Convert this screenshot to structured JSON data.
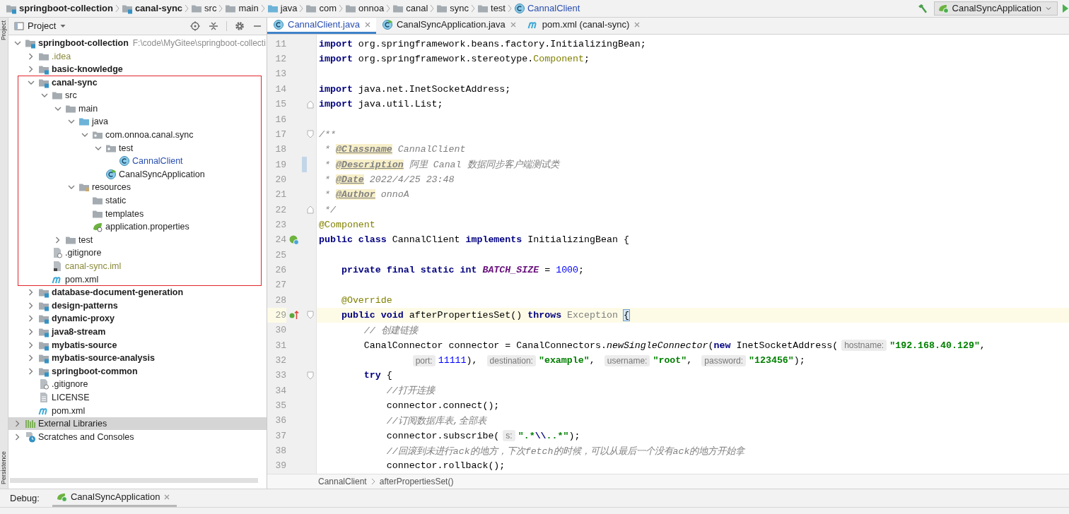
{
  "breadcrumbs": [
    {
      "label": "springboot-collection",
      "kind": "module"
    },
    {
      "label": "canal-sync",
      "kind": "module"
    },
    {
      "label": "src",
      "kind": "folder"
    },
    {
      "label": "main",
      "kind": "folder"
    },
    {
      "label": "java",
      "kind": "source-folder"
    },
    {
      "label": "com",
      "kind": "folder"
    },
    {
      "label": "onnoa",
      "kind": "folder"
    },
    {
      "label": "canal",
      "kind": "folder"
    },
    {
      "label": "sync",
      "kind": "folder"
    },
    {
      "label": "test",
      "kind": "folder"
    },
    {
      "label": "CannalClient",
      "kind": "class"
    }
  ],
  "run_config": {
    "label": "CanalSyncApplication"
  },
  "tool_strip": [
    "Project",
    "Persistence"
  ],
  "project_panel": {
    "title": "Project"
  },
  "project_tree": [
    {
      "label": "springboot-collection",
      "kind": "module",
      "path": "F:\\code\\MyGitee\\springboot-collecti",
      "expanded": true,
      "selected": false,
      "highlighted": false,
      "children": [
        {
          "label": ".idea",
          "kind": "folder",
          "color": "#8a8a3c",
          "expanded": false,
          "selected": false,
          "highlighted": false
        },
        {
          "label": "basic-knowledge",
          "kind": "module",
          "expanded": false,
          "selected": false,
          "highlighted": false
        },
        {
          "label": "canal-sync",
          "kind": "module",
          "expanded": true,
          "selected": false,
          "highlighted": true,
          "children": [
            {
              "label": "src",
              "kind": "folder",
              "expanded": true,
              "selected": false,
              "highlighted": false,
              "children": [
                {
                  "label": "main",
                  "kind": "folder",
                  "expanded": true,
                  "selected": false,
                  "highlighted": false,
                  "children": [
                    {
                      "label": "java",
                      "kind": "source-folder",
                      "expanded": true,
                      "selected": false,
                      "highlighted": false,
                      "children": [
                        {
                          "label": "com.onnoa.canal.sync",
                          "kind": "package",
                          "expanded": true,
                          "selected": false,
                          "highlighted": false,
                          "children": [
                            {
                              "label": "test",
                              "kind": "package",
                              "expanded": true,
                              "selected": false,
                              "highlighted": false,
                              "children": [
                                {
                                  "label": "CannalClient",
                                  "kind": "class",
                                  "color": "#2a4fb0",
                                  "selected": false,
                                  "highlighted": false
                                }
                              ]
                            },
                            {
                              "label": "CanalSyncApplication",
                              "kind": "spring-class",
                              "selected": false,
                              "highlighted": false
                            }
                          ]
                        }
                      ]
                    },
                    {
                      "label": "resources",
                      "kind": "resources-folder",
                      "expanded": true,
                      "selected": false,
                      "highlighted": false,
                      "children": [
                        {
                          "label": "static",
                          "kind": "folder",
                          "selected": false,
                          "highlighted": false
                        },
                        {
                          "label": "templates",
                          "kind": "folder",
                          "selected": false,
                          "highlighted": false
                        },
                        {
                          "label": "application.properties",
                          "kind": "properties",
                          "selected": false,
                          "highlighted": false
                        }
                      ]
                    }
                  ]
                },
                {
                  "label": "test",
                  "kind": "folder",
                  "expanded": false,
                  "selected": false,
                  "highlighted": false
                }
              ]
            },
            {
              "label": ".gitignore",
              "kind": "gitignore",
              "selected": false,
              "highlighted": false
            },
            {
              "label": "canal-sync.iml",
              "kind": "iml",
              "color": "#8a8a3c",
              "selected": false,
              "highlighted": false
            },
            {
              "label": "pom.xml",
              "kind": "pom",
              "selected": false,
              "highlighted": false
            }
          ]
        },
        {
          "label": "database-document-generation",
          "kind": "module",
          "expanded": false,
          "selected": false,
          "highlighted": false
        },
        {
          "label": "design-patterns",
          "kind": "module",
          "expanded": false,
          "selected": false,
          "highlighted": false
        },
        {
          "label": "dynamic-proxy",
          "kind": "module",
          "expanded": false,
          "selected": false,
          "highlighted": false
        },
        {
          "label": "java8-stream",
          "kind": "module",
          "expanded": false,
          "selected": false,
          "highlighted": false
        },
        {
          "label": "mybatis-source",
          "kind": "module",
          "expanded": false,
          "selected": false,
          "highlighted": false
        },
        {
          "label": "mybatis-source-analysis",
          "kind": "module",
          "expanded": false,
          "selected": false,
          "highlighted": false
        },
        {
          "label": "springboot-common",
          "kind": "module",
          "expanded": false,
          "selected": false,
          "highlighted": false
        },
        {
          "label": ".gitignore",
          "kind": "gitignore",
          "selected": false,
          "highlighted": false
        },
        {
          "label": "LICENSE",
          "kind": "text-file",
          "selected": false,
          "highlighted": false
        },
        {
          "label": "pom.xml",
          "kind": "pom",
          "selected": false,
          "highlighted": false
        }
      ]
    },
    {
      "label": "External Libraries",
      "kind": "libraries",
      "expanded": false,
      "selected": true,
      "highlighted": false
    },
    {
      "label": "Scratches and Consoles",
      "kind": "scratches",
      "expanded": false,
      "selected": false,
      "highlighted": false
    }
  ],
  "tabs": [
    {
      "label": "CannalClient.java",
      "kind": "class",
      "selected": true
    },
    {
      "label": "CanalSyncApplication.java",
      "kind": "spring-class",
      "selected": false
    },
    {
      "label": "pom.xml (canal-sync)",
      "kind": "pom",
      "selected": false
    }
  ],
  "code_lines": [
    {
      "number": "11",
      "kind": "code",
      "current": false,
      "tokens": [
        {
          "kind": "kw",
          "text": "import "
        },
        {
          "kind": "plain",
          "text": "org.springframework.beans.factory.InitializingBean;"
        }
      ]
    },
    {
      "number": "12",
      "kind": "code",
      "current": false,
      "tokens": [
        {
          "kind": "kw",
          "text": "import "
        },
        {
          "kind": "plain",
          "text": "org.springframework.stereotype."
        },
        {
          "kind": "anno",
          "text": "Component"
        },
        {
          "kind": "plain",
          "text": ";"
        }
      ]
    },
    {
      "number": "13",
      "kind": "blank",
      "current": false
    },
    {
      "number": "14",
      "kind": "code",
      "current": false,
      "tokens": [
        {
          "kind": "kw",
          "text": "import "
        },
        {
          "kind": "plain",
          "text": "java.net.InetSocketAddress;"
        }
      ]
    },
    {
      "number": "15",
      "kind": "code",
      "current": false,
      "fold": {
        "kind": "end"
      },
      "tokens": [
        {
          "kind": "kw",
          "text": "import "
        },
        {
          "kind": "plain",
          "text": "java.util.List;"
        }
      ]
    },
    {
      "number": "16",
      "kind": "blank",
      "current": false
    },
    {
      "number": "17",
      "kind": "code",
      "current": false,
      "fold": {
        "kind": "start"
      },
      "tokens": [
        {
          "kind": "doc",
          "text": "/**"
        }
      ]
    },
    {
      "number": "18",
      "kind": "code",
      "current": false,
      "tokens": [
        {
          "kind": "doc",
          "text": " * "
        },
        {
          "kind": "doctag",
          "text": "@Classname"
        },
        {
          "kind": "doc",
          "text": " CannalClient"
        }
      ]
    },
    {
      "number": "19",
      "kind": "code",
      "current": false,
      "change": {
        "kind": "modified"
      },
      "tokens": [
        {
          "kind": "doc",
          "text": " * "
        },
        {
          "kind": "doctag",
          "text": "@Description"
        },
        {
          "kind": "doc",
          "text": " 阿里 Canal 数据同步客户端测试类"
        }
      ]
    },
    {
      "number": "20",
      "kind": "code",
      "current": false,
      "tokens": [
        {
          "kind": "doc",
          "text": " * "
        },
        {
          "kind": "doctag",
          "text": "@Date"
        },
        {
          "kind": "doc",
          "text": " 2022/4/25 23:48"
        }
      ]
    },
    {
      "number": "21",
      "kind": "code",
      "current": false,
      "tokens": [
        {
          "kind": "doc",
          "text": " * "
        },
        {
          "kind": "doctag",
          "text": "@Author"
        },
        {
          "kind": "doc",
          "text": " onnoA"
        }
      ]
    },
    {
      "number": "22",
      "kind": "code",
      "current": false,
      "fold": {
        "kind": "end"
      },
      "tokens": [
        {
          "kind": "doc",
          "text": " */"
        }
      ]
    },
    {
      "number": "23",
      "kind": "code",
      "current": false,
      "tokens": [
        {
          "kind": "anno",
          "text": "@Component"
        }
      ]
    },
    {
      "number": "24",
      "kind": "code",
      "current": false,
      "gutter_marker": {
        "kind": "bean"
      },
      "tokens": [
        {
          "kind": "kw",
          "text": "public class "
        },
        {
          "kind": "plain",
          "text": "CannalClient "
        },
        {
          "kind": "kw",
          "text": "implements "
        },
        {
          "kind": "plain",
          "text": "InitializingBean {"
        }
      ]
    },
    {
      "number": "25",
      "kind": "blank",
      "current": false
    },
    {
      "number": "26",
      "kind": "code",
      "current": false,
      "tokens": [
        {
          "kind": "kw",
          "text": "    private final static int "
        },
        {
          "kind": "const",
          "text": "BATCH_SIZE"
        },
        {
          "kind": "plain",
          "text": " = "
        },
        {
          "kind": "num",
          "text": "1000"
        },
        {
          "kind": "plain",
          "text": ";"
        }
      ]
    },
    {
      "number": "27",
      "kind": "blank",
      "current": false
    },
    {
      "number": "28",
      "kind": "code",
      "current": false,
      "tokens": [
        {
          "kind": "anno",
          "text": "    @Override"
        }
      ]
    },
    {
      "number": "29",
      "kind": "code",
      "current": true,
      "gutter_marker": {
        "kind": "implements"
      },
      "fold": {
        "kind": "start"
      },
      "tokens": [
        {
          "kind": "kw",
          "text": "    public void "
        },
        {
          "kind": "plain",
          "text": "afterPropertiesSet() "
        },
        {
          "kind": "kw",
          "text": "throws "
        },
        {
          "kind": "muted",
          "text": "Exception "
        },
        {
          "kind": "brace",
          "text": "{"
        }
      ]
    },
    {
      "number": "30",
      "kind": "code",
      "current": false,
      "tokens": [
        {
          "kind": "comment",
          "text": "        // 创建链接"
        }
      ]
    },
    {
      "number": "31",
      "kind": "code",
      "current": false,
      "tokens": [
        {
          "kind": "plain",
          "text": "        CanalConnector connector = CanalConnectors."
        },
        {
          "kind": "static",
          "text": "newSingleConnector"
        },
        {
          "kind": "plain",
          "text": "("
        },
        {
          "kind": "kw",
          "text": "new "
        },
        {
          "kind": "plain",
          "text": "InetSocketAddress("
        },
        {
          "kind": "hint",
          "text": "hostname:"
        },
        {
          "kind": "str",
          "text": "\"192.168.40.129\""
        },
        {
          "kind": "plain",
          "text": ","
        }
      ]
    },
    {
      "number": "32",
      "kind": "continuation",
      "current": false,
      "tokens": [
        {
          "kind": "hint",
          "text": "port:"
        },
        {
          "kind": "num",
          "text": "11111"
        },
        {
          "kind": "plain",
          "text": "), "
        },
        {
          "kind": "hint",
          "text": "destination:"
        },
        {
          "kind": "str",
          "text": "\"example\""
        },
        {
          "kind": "plain",
          "text": ", "
        },
        {
          "kind": "hint",
          "text": "username:"
        },
        {
          "kind": "str",
          "text": "\"root\""
        },
        {
          "kind": "plain",
          "text": ", "
        },
        {
          "kind": "hint",
          "text": "password:"
        },
        {
          "kind": "str",
          "text": "\"123456\""
        },
        {
          "kind": "plain",
          "text": ");"
        }
      ]
    },
    {
      "number": "33",
      "kind": "code",
      "current": false,
      "fold": {
        "kind": "start"
      },
      "tokens": [
        {
          "kind": "kw",
          "text": "        try "
        },
        {
          "kind": "plain",
          "text": "{"
        }
      ]
    },
    {
      "number": "34",
      "kind": "code",
      "current": false,
      "tokens": [
        {
          "kind": "comment",
          "text": "            //打开连接"
        }
      ]
    },
    {
      "number": "35",
      "kind": "code",
      "current": false,
      "tokens": [
        {
          "kind": "plain",
          "text": "            connector.connect();"
        }
      ]
    },
    {
      "number": "36",
      "kind": "code",
      "current": false,
      "tokens": [
        {
          "kind": "comment",
          "text": "            //订阅数据库表,全部表"
        }
      ]
    },
    {
      "number": "37",
      "kind": "code",
      "current": false,
      "tokens": [
        {
          "kind": "plain",
          "text": "            connector.subscribe("
        },
        {
          "kind": "hint",
          "text": "s:"
        },
        {
          "kind": "str",
          "text": "\".*"
        },
        {
          "kind": "escape",
          "text": "\\\\"
        },
        {
          "kind": "str",
          "text": "..*\""
        },
        {
          "kind": "plain",
          "text": ");"
        }
      ]
    },
    {
      "number": "38",
      "kind": "code",
      "current": false,
      "tokens": [
        {
          "kind": "comment",
          "text": "            //回滚到未进行ack的地方，下次fetch的时候，可以从最后一个没有ack的地方开始拿"
        }
      ]
    },
    {
      "number": "39",
      "kind": "code",
      "current": false,
      "tokens": [
        {
          "kind": "plain",
          "text": "            connector.rollback();"
        }
      ]
    }
  ],
  "editor_breadcrumbs": [
    "CannalClient",
    "afterPropertiesSet()"
  ],
  "debug": {
    "label": "Debug:",
    "tab": "CanalSyncApplication"
  }
}
